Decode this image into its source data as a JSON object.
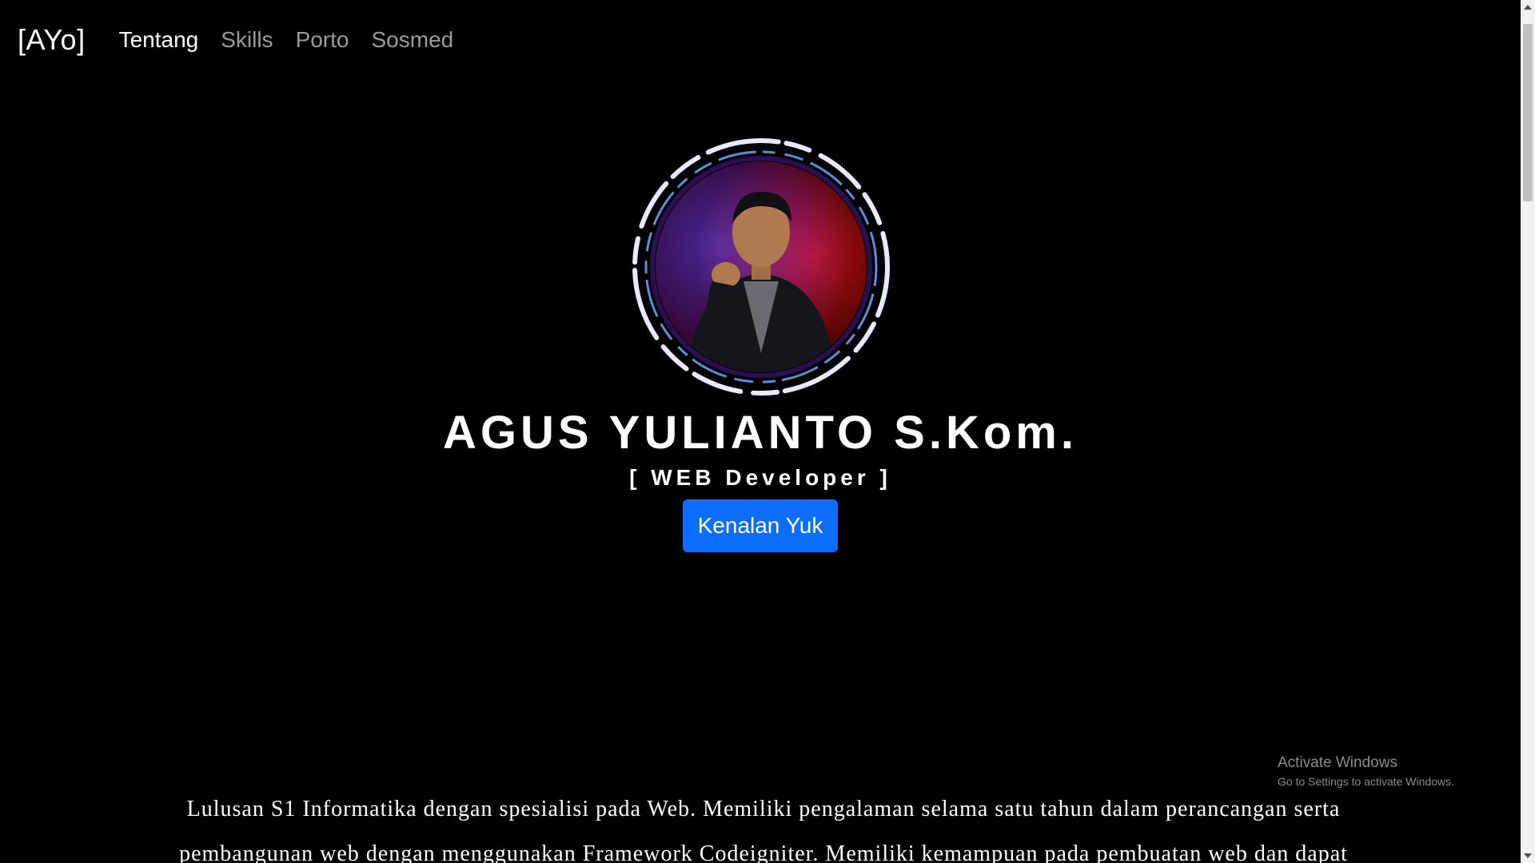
{
  "navbar": {
    "brand": "[AYo]",
    "links": [
      {
        "label": "Tentang",
        "active": true
      },
      {
        "label": "Skills",
        "active": false
      },
      {
        "label": "Porto",
        "active": false
      },
      {
        "label": "Sosmed",
        "active": false
      }
    ]
  },
  "hero": {
    "avatar_icon": "profile-photo",
    "name": "AGUS YULIANTO S.Kom.",
    "role": "[ WEB Developer ]",
    "cta_label": "Kenalan Yuk"
  },
  "about": {
    "text": "Lulusan S1 Informatika dengan spesialisi pada Web. Memiliki pengalaman selama satu tahun dalam perancangan serta pembangunan web dengan menggunakan Framework Codeigniter. Memiliki kemampuan pada pembuatan web dan dapat"
  },
  "watermark": {
    "title": "Activate Windows",
    "subtitle": "Go to Settings to activate Windows."
  },
  "colors": {
    "background": "#000000",
    "accent": "#0d6efd",
    "nav_inactive": "#9a9a9a",
    "ring_outer": "#e8e8ff",
    "ring_inner": "#5b8fd9"
  }
}
